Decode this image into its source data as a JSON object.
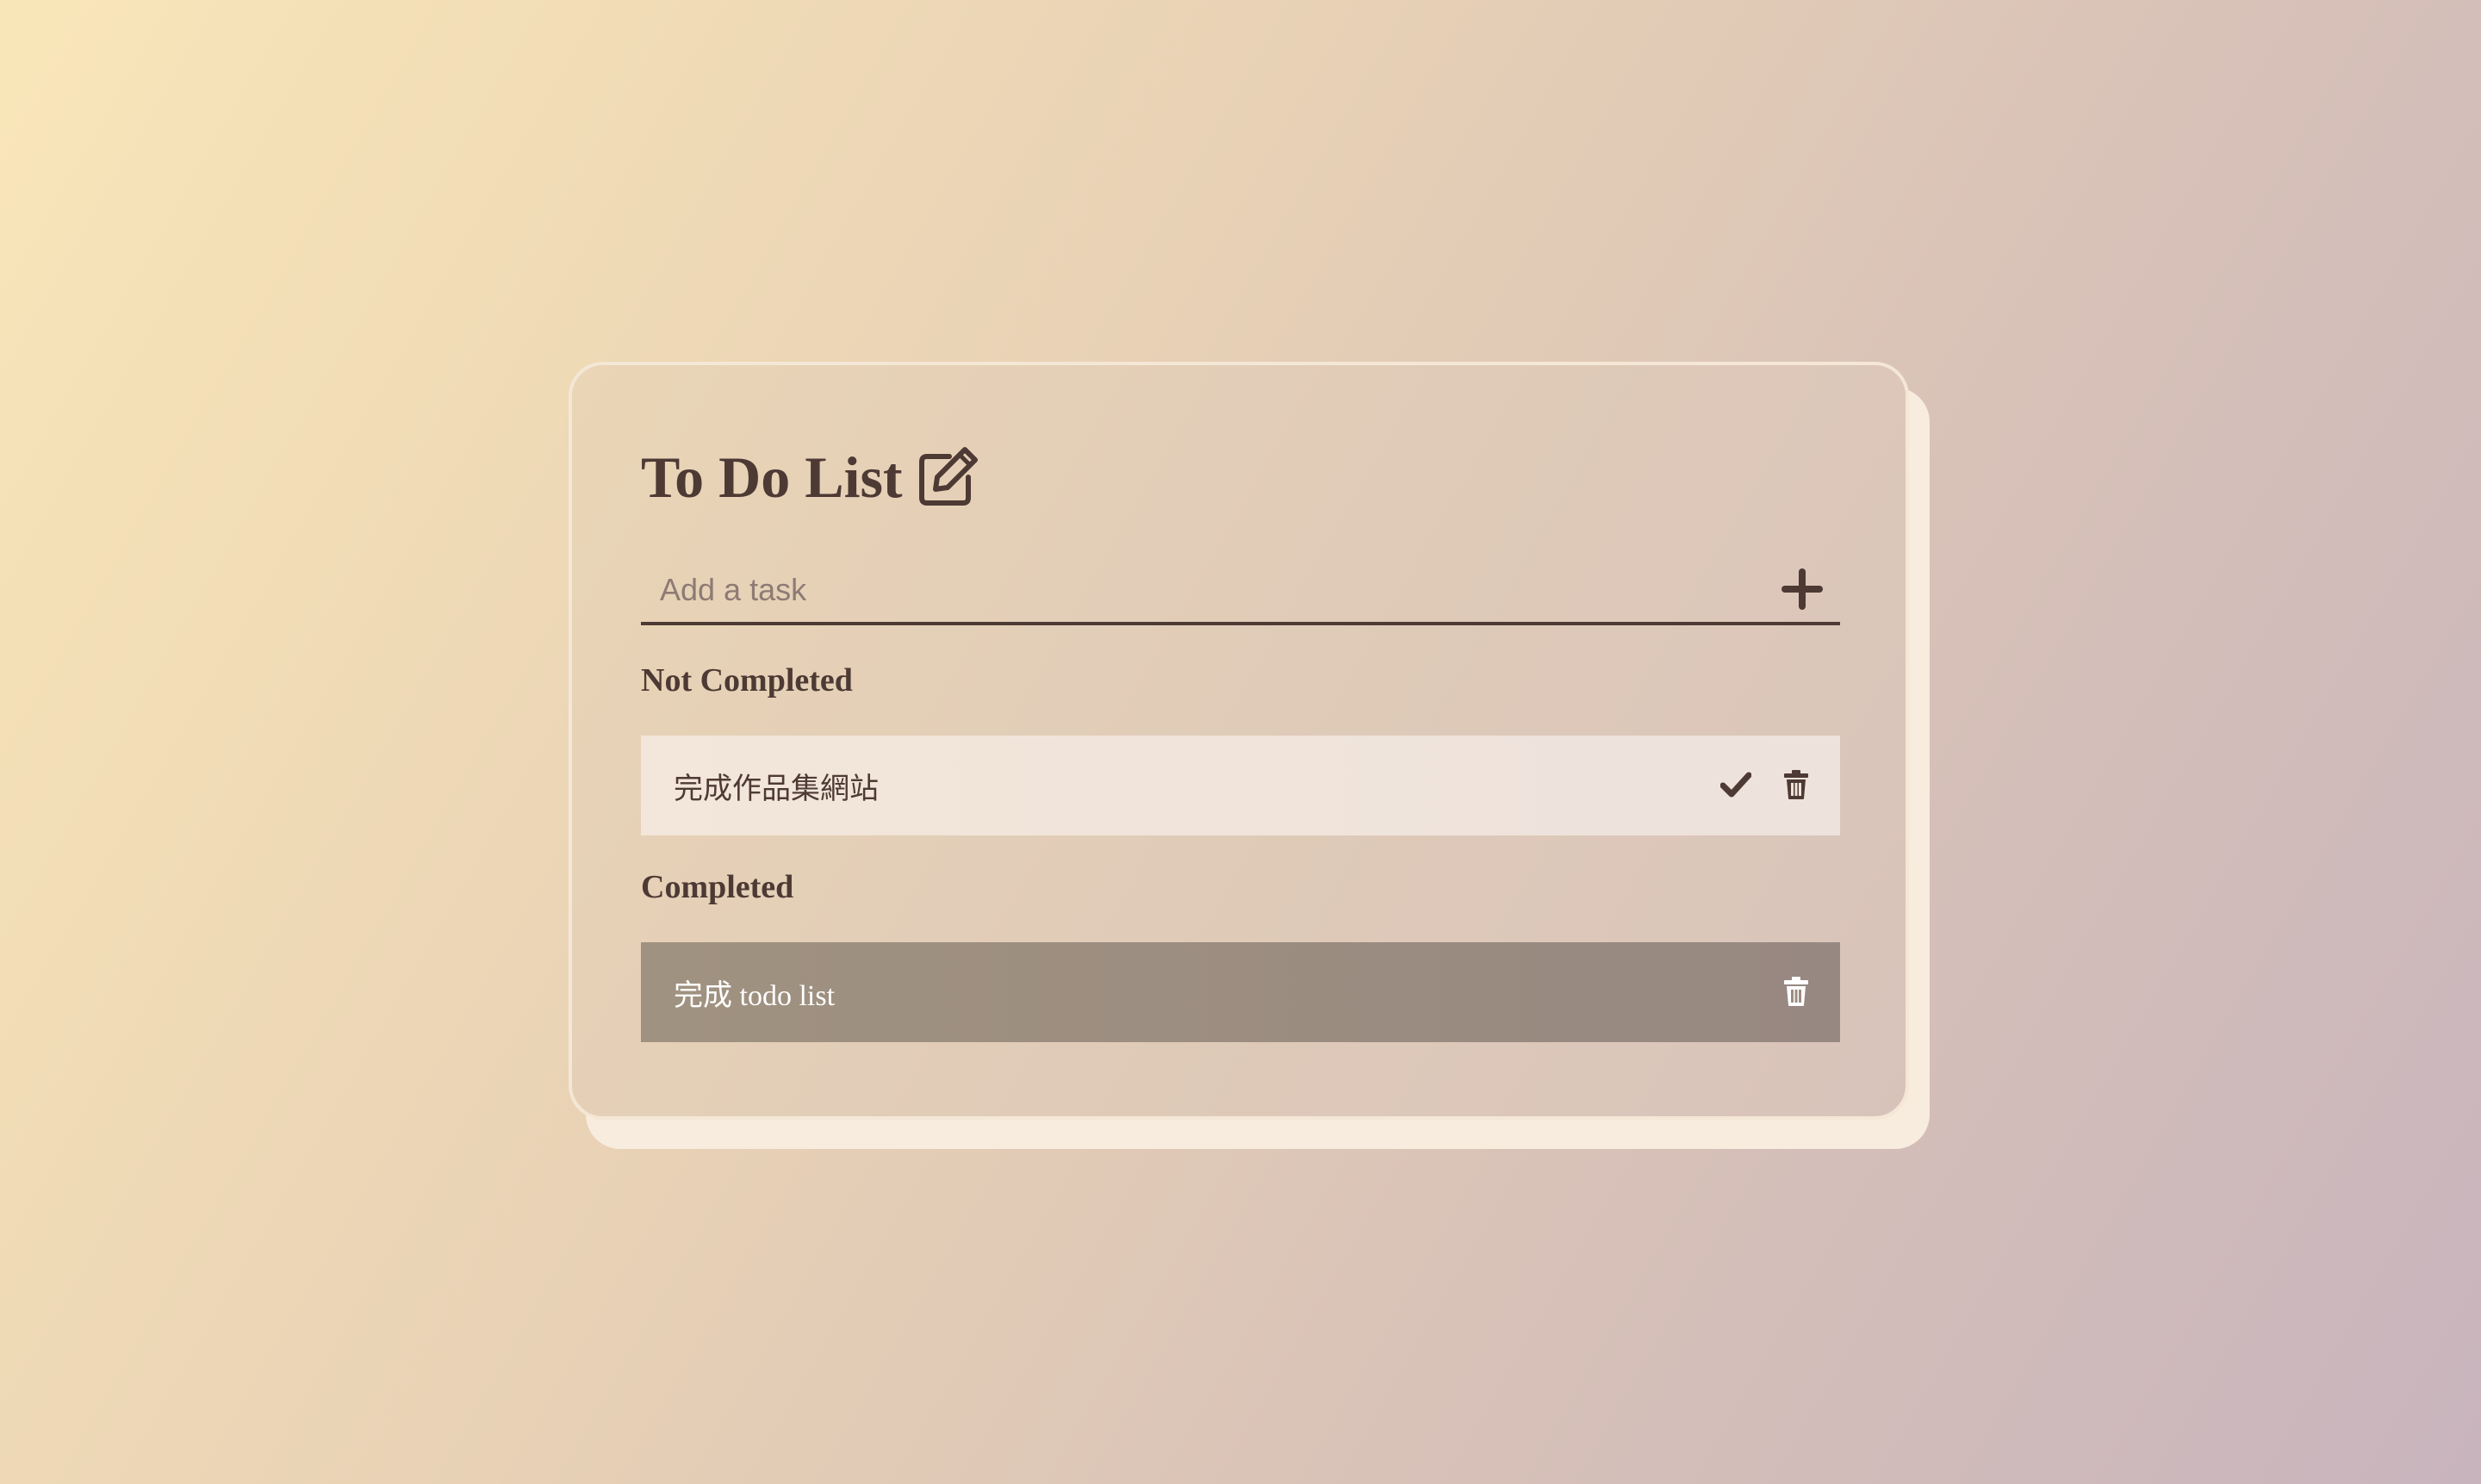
{
  "app": {
    "title": "To Do List"
  },
  "input": {
    "placeholder": "Add a task",
    "value": ""
  },
  "sections": {
    "not_completed": {
      "heading": "Not Completed",
      "tasks": [
        {
          "text": "完成作品集網站"
        }
      ]
    },
    "completed": {
      "heading": "Completed",
      "tasks": [
        {
          "text": "完成 todo list"
        }
      ]
    }
  },
  "icons": {
    "title": "edit-icon",
    "add": "plus-icon",
    "complete": "check-icon",
    "delete": "trash-icon"
  },
  "colors": {
    "text_dark": "#4e3a34",
    "open_task_bg": "#f0e4db",
    "done_task_bg": "#9c8d80",
    "done_task_text": "#ffffff",
    "card_border": "#f4e7d6"
  }
}
